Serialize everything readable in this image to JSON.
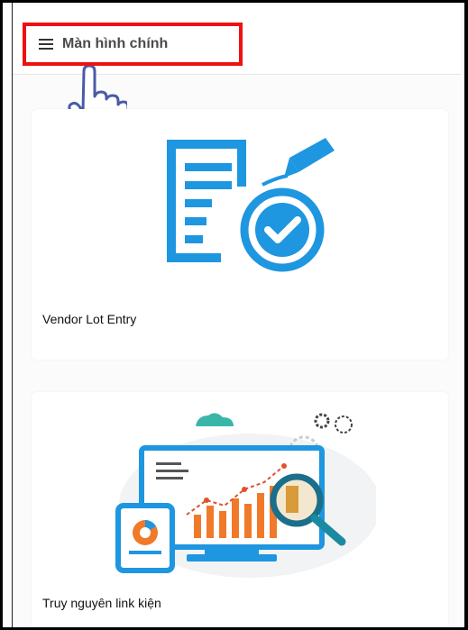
{
  "header": {
    "menu_icon": "hamburger-icon",
    "title": "Màn hình chính"
  },
  "cards": [
    {
      "label": "Vendor Lot Entry",
      "icon": "document-check-icon"
    },
    {
      "label": "Truy nguyên link kiện",
      "icon": "analytics-magnifier-icon"
    }
  ],
  "colors": {
    "highlight": "#ee1111",
    "accent_blue": "#1e96e0",
    "orange": "#f07a2a",
    "hand_blue": "#4a5ba8"
  }
}
